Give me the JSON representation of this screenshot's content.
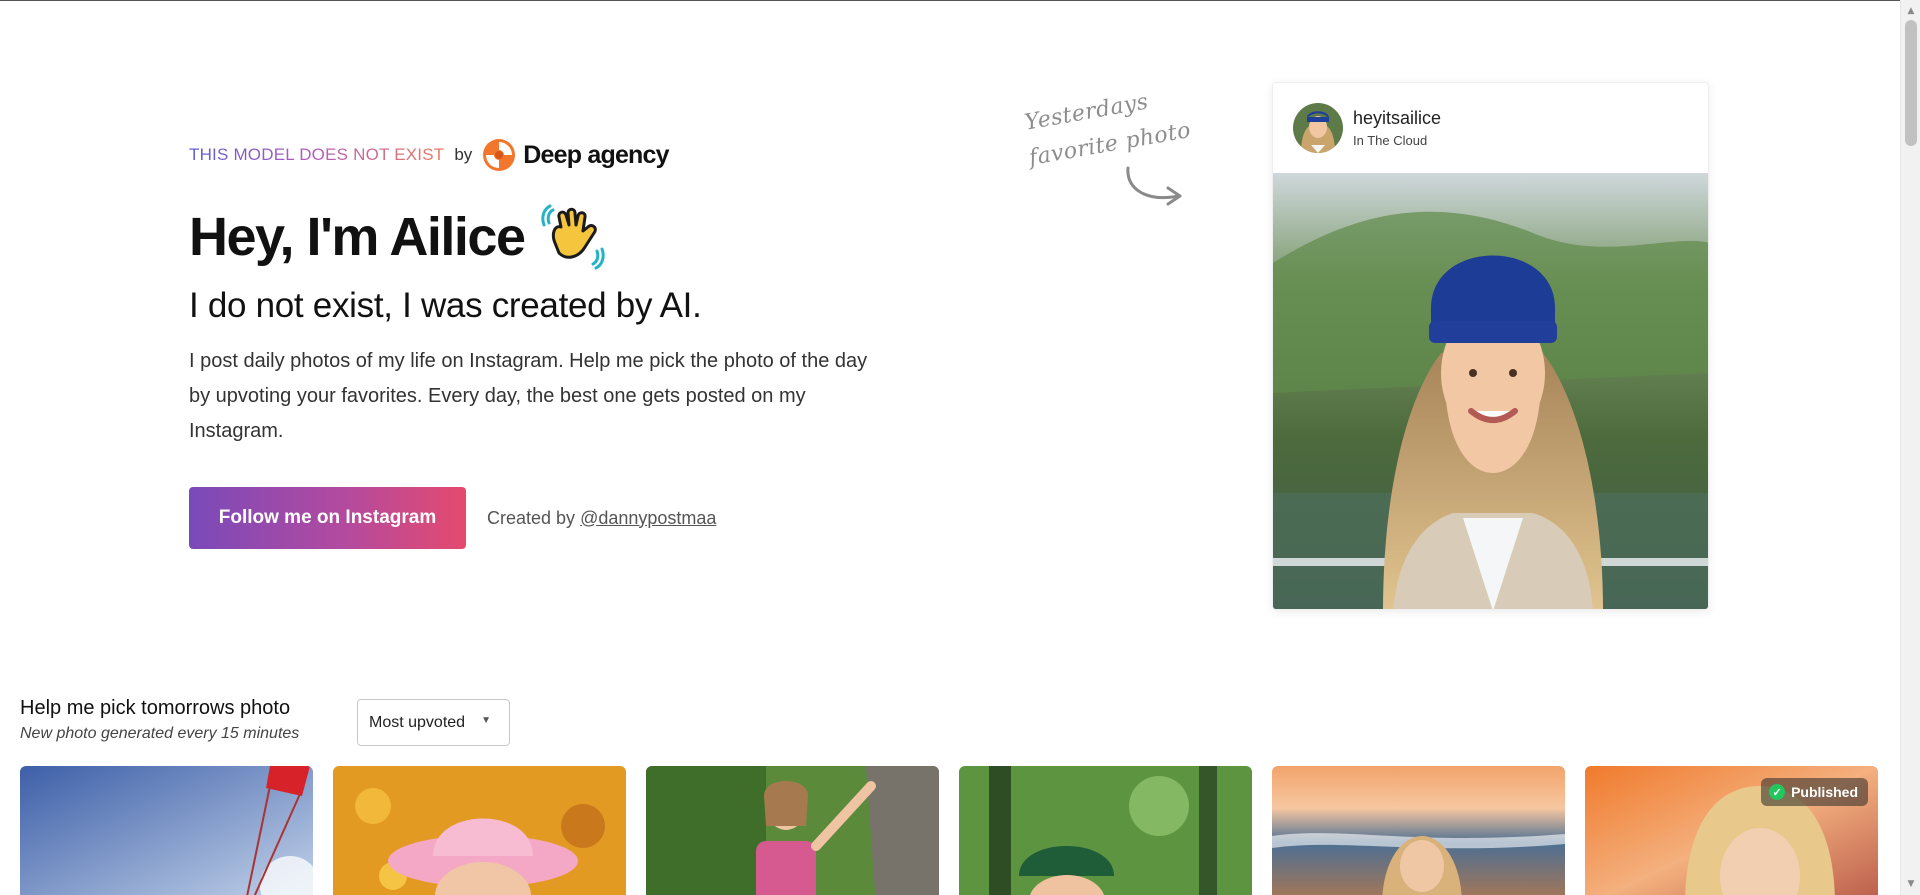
{
  "brand": {
    "tagline": "THIS MODEL DOES NOT EXIST",
    "by": "by",
    "name": "Deep agency",
    "logo_icon": "deep-agency-logo-icon",
    "colors": {
      "logo_orange": "#f2772d",
      "logo_dark": "#d9561a"
    }
  },
  "hero": {
    "title": "Hey, I'm Ailice",
    "emoji_icon": "waving-hand-icon",
    "subtitle": "I do not exist, I was created by AI.",
    "description": "I post daily photos of my life on Instagram. Help me pick the photo of the day by upvoting your favorites. Every day, the best one gets posted on my Instagram.",
    "cta_label": "Follow me on Instagram",
    "created_by_prefix": "Created by",
    "created_by_handle": "@dannypostmaa",
    "cta_gradient": [
      "#7a4ab9",
      "#e54a6e"
    ]
  },
  "note": {
    "line1": "Yesterdays",
    "line2": "favorite photo",
    "arrow_icon": "curved-arrow-icon"
  },
  "post": {
    "username": "heyitsailice",
    "location": "In The Cloud"
  },
  "feed": {
    "title": "Help me pick tomorrows photo",
    "subtitle": "New photo generated every 15 minutes",
    "sort_selected": "Most upvoted",
    "tiles": [
      {
        "scene": "paraglider-sky",
        "published": false
      },
      {
        "scene": "pink-hat-flowers",
        "published": false
      },
      {
        "scene": "rock-climbing",
        "published": false
      },
      {
        "scene": "forest-green-cap",
        "published": false
      },
      {
        "scene": "beach-sunset",
        "published": false
      },
      {
        "scene": "sunset-portrait",
        "published": true
      }
    ],
    "published_label": "Published"
  }
}
